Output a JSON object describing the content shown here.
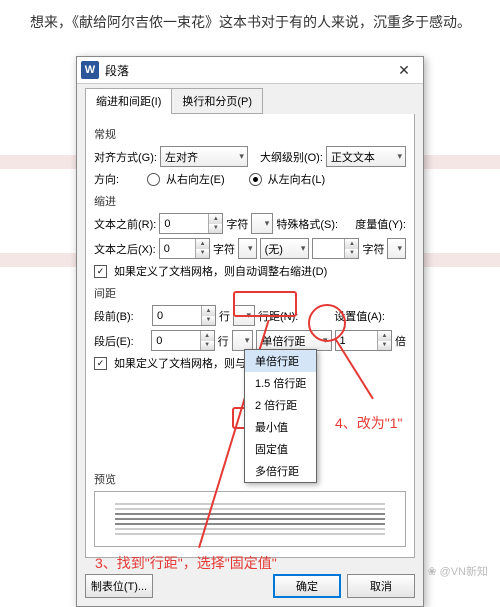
{
  "background_text": "想来，《献给阿尔吉侬一束花》这本书对于有的人来说，沉重多于感动。",
  "dialog": {
    "title": "段落",
    "tabs": {
      "active": "缩进和间距(I)",
      "inactive": "换行和分页(P)"
    },
    "sections": {
      "general": "常规",
      "indent": "缩进",
      "spacing": "间距",
      "preview": "预览"
    },
    "general": {
      "align_label": "对齐方式(G):",
      "align_value": "左对齐",
      "outline_label": "大纲级别(O):",
      "outline_value": "正文文本",
      "direction_label": "方向:",
      "rtl_label": "从右向左(E)",
      "ltr_label": "从左向右(L)"
    },
    "indent": {
      "before_label": "文本之前(R):",
      "before_value": "0",
      "unit1": "字符",
      "special_label": "特殊格式(S):",
      "special_value": "",
      "measure_label": "度量值(Y):",
      "after_label": "文本之后(X):",
      "after_value": "0",
      "unit2": "字符",
      "special2_value": "(无)",
      "measure2_value": "",
      "unit3": "字符",
      "grid_check": "如果定义了文档网格，则自动调整右缩进(D)"
    },
    "spacing": {
      "before_label": "段前(B):",
      "before_value": "0",
      "unit1": "行",
      "line_label": "行距(N):",
      "setat_label": "设置值(A):",
      "after_label": "段后(E):",
      "after_value": "0",
      "unit2": "行",
      "line_value": "单倍行距",
      "setat_value": "1",
      "unit3": "倍",
      "grid_check": "如果定义了文档网格，则与网格",
      "options": [
        "单倍行距",
        "1.5 倍行距",
        "2 倍行距",
        "最小值",
        "固定值",
        "多倍行距"
      ]
    },
    "buttons": {
      "tabstop": "制表位(T)...",
      "ok": "确定",
      "cancel": "取消"
    }
  },
  "annotations": {
    "step3": "3、找到\"行距\"，选择\"固定值\"",
    "step4": "4、改为\"1\""
  },
  "watermark": "@VN新知"
}
